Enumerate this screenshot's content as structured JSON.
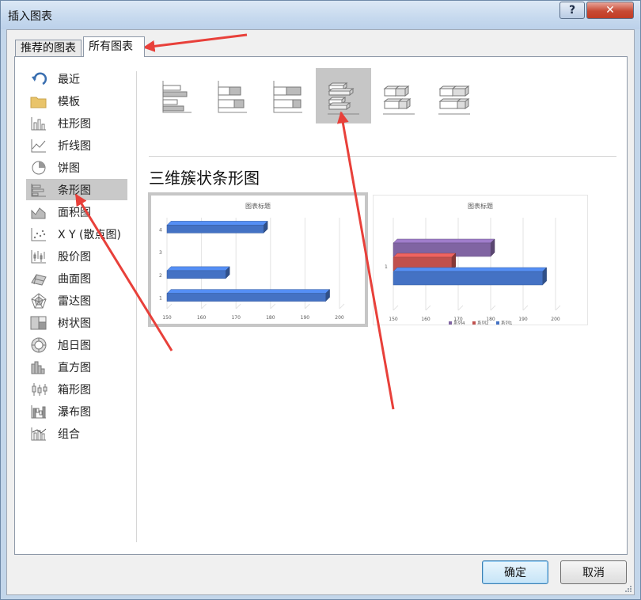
{
  "window": {
    "title": "插入图表",
    "help_label": "?",
    "close_label": "✕"
  },
  "tabs": [
    {
      "label": "推荐的图表"
    },
    {
      "label": "所有图表"
    }
  ],
  "categories": [
    {
      "label": "最近",
      "icon": "undo-arrow-icon"
    },
    {
      "label": "模板",
      "icon": "folder-icon"
    },
    {
      "label": "柱形图",
      "icon": "column-chart-icon"
    },
    {
      "label": "折线图",
      "icon": "line-chart-icon"
    },
    {
      "label": "饼图",
      "icon": "pie-chart-icon"
    },
    {
      "label": "条形图",
      "icon": "bar-chart-icon",
      "selected": true
    },
    {
      "label": "面积图",
      "icon": "area-chart-icon"
    },
    {
      "label": "X Y (散点图)",
      "icon": "scatter-chart-icon"
    },
    {
      "label": "股价图",
      "icon": "stock-chart-icon"
    },
    {
      "label": "曲面图",
      "icon": "surface-chart-icon"
    },
    {
      "label": "雷达图",
      "icon": "radar-chart-icon"
    },
    {
      "label": "树状图",
      "icon": "treemap-chart-icon"
    },
    {
      "label": "旭日图",
      "icon": "sunburst-chart-icon"
    },
    {
      "label": "直方图",
      "icon": "histogram-chart-icon"
    },
    {
      "label": "箱形图",
      "icon": "box-whisker-chart-icon"
    },
    {
      "label": "瀑布图",
      "icon": "waterfall-chart-icon"
    },
    {
      "label": "组合",
      "icon": "combo-chart-icon"
    }
  ],
  "subtype_icons": [
    "clustered-bar-icon",
    "stacked-bar-icon",
    "percent-stacked-bar-icon",
    "3d-clustered-bar-icon",
    "3d-stacked-bar-icon",
    "3d-percent-stacked-bar-icon"
  ],
  "selected_subtype": 3,
  "subtype_heading": "三维簇状条形图",
  "buttons": {
    "ok": "确定",
    "cancel": "取消"
  },
  "colors": {
    "series1": "#4472c4",
    "series2": "#c0504d",
    "series4": "#8064a2",
    "selection": "#c6c6c6",
    "annotation_arrow": "#e8403a"
  },
  "chart_data": [
    {
      "type": "bar",
      "title": "图表标题",
      "categories": [
        "1",
        "2",
        "3",
        "4"
      ],
      "values": [
        196,
        167,
        null,
        178
      ],
      "xlim": [
        150,
        200
      ],
      "xticks": [
        "150",
        "160",
        "170",
        "180",
        "190",
        "200"
      ]
    },
    {
      "type": "bar",
      "title": "图表标题",
      "categories": [
        "1"
      ],
      "series": [
        {
          "name": "系列4",
          "values": [
            180
          ]
        },
        {
          "name": "系列2",
          "values": [
            168
          ]
        },
        {
          "name": "系列1",
          "values": [
            196
          ]
        }
      ],
      "legend": [
        "系列4",
        "系列2",
        "系列1"
      ],
      "xlim": [
        150,
        200
      ],
      "xticks": [
        "150",
        "160",
        "170",
        "180",
        "190",
        "200"
      ]
    }
  ]
}
